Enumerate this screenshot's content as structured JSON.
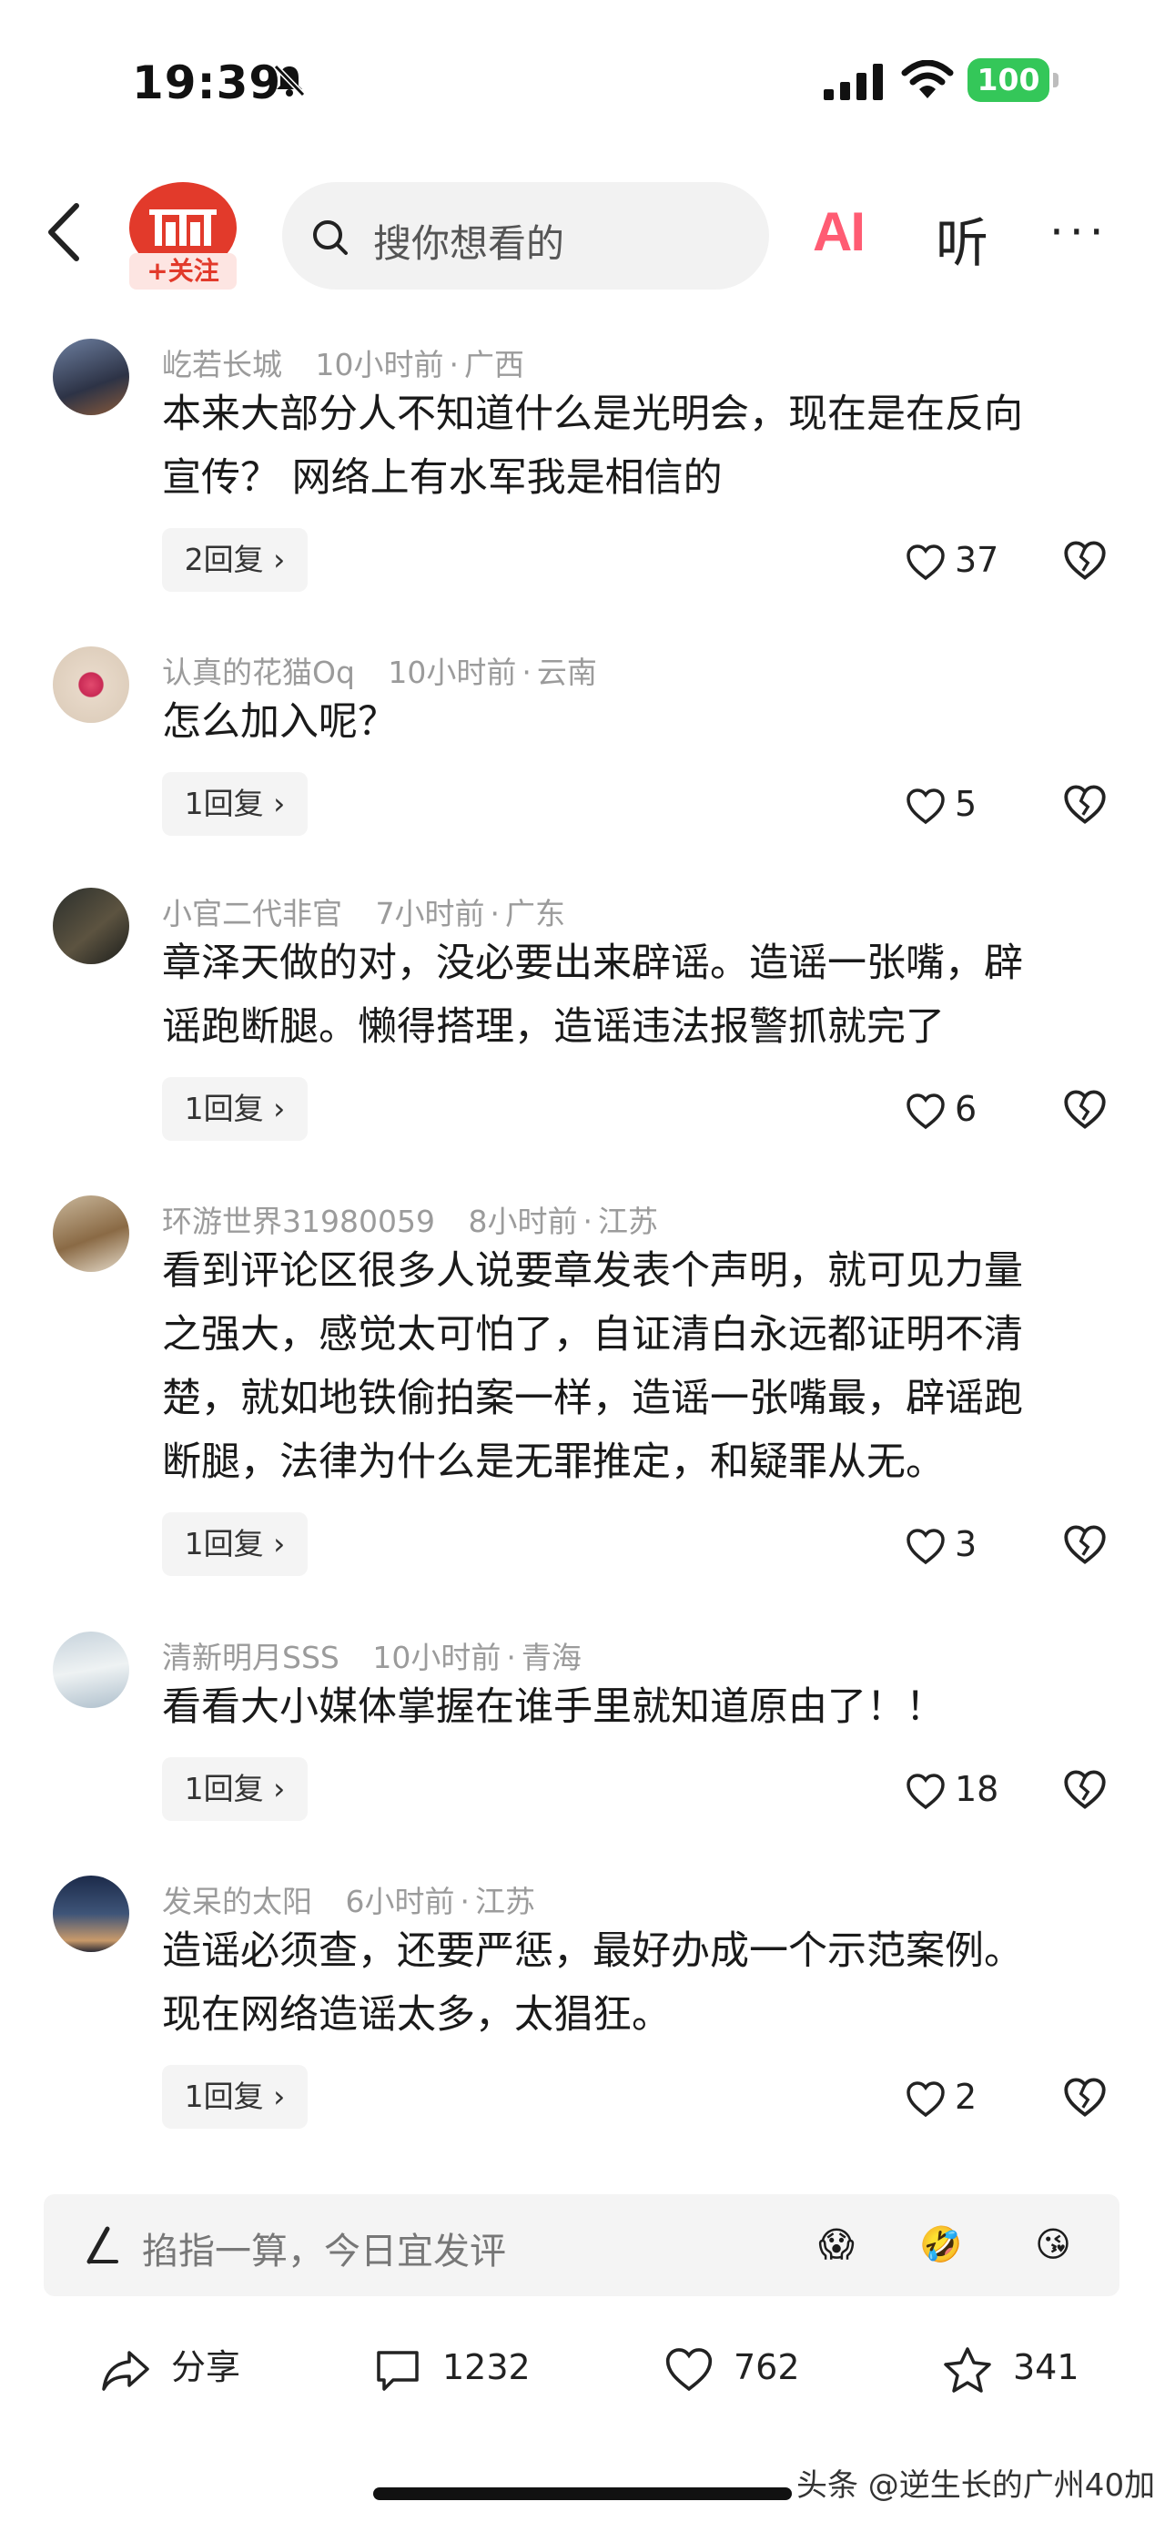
{
  "status": {
    "time": "19:39",
    "battery": "100"
  },
  "nav": {
    "follow_label": "+关注",
    "search_placeholder": "搜你想看的",
    "ai_label": "AI",
    "listen_label": "听",
    "more_label": "···"
  },
  "comments": [
    {
      "user": "屹若长城",
      "time": "10小时前",
      "region": "广西",
      "lines": [
        "本来大部分人不知道什么是光明会，现在是在反向",
        "宣传？ 网络上有水军我是相信的"
      ],
      "replies": "2回复",
      "likes": "37"
    },
    {
      "user": "认真的花猫Oq",
      "time": "10小时前",
      "region": "云南",
      "lines": [
        "怎么加入呢？"
      ],
      "replies": "1回复",
      "likes": "5"
    },
    {
      "user": "小官二代非官",
      "time": "7小时前",
      "region": "广东",
      "lines": [
        "章泽天做的对，没必要出来辟谣。造谣一张嘴，辟",
        "谣跑断腿。懒得搭理，造谣违法报警抓就完了"
      ],
      "replies": "1回复",
      "likes": "6"
    },
    {
      "user": "环游世界31980059",
      "time": "8小时前",
      "region": "江苏",
      "lines": [
        "看到评论区很多人说要章发表个声明，就可见力量",
        "之强大，感觉太可怕了，自证清白永远都证明不清",
        "楚，就如地铁偷拍案一样，造谣一张嘴最，辟谣跑",
        "断腿，法律为什么是无罪推定，和疑罪从无。"
      ],
      "replies": "1回复",
      "likes": "3"
    },
    {
      "user": "清新明月SSS",
      "time": "10小时前",
      "region": "青海",
      "lines": [
        "看看大小媒体掌握在谁手里就知道原由了！！"
      ],
      "replies": "1回复",
      "likes": "18"
    },
    {
      "user": "发呆的太阳",
      "time": "6小时前",
      "region": "江苏",
      "lines": [
        "造谣必须查，还要严惩，最好办成一个示范案例。",
        "现在网络造谣太多，太猖狂。"
      ],
      "replies": "1回复",
      "likes": "2"
    }
  ],
  "input": {
    "placeholder": "掐指一算，今日宜发评",
    "emojis": [
      "😱",
      "🤣",
      "😘"
    ]
  },
  "actions": {
    "share": "分享",
    "comments": "1232",
    "likes": "762",
    "favorites": "341"
  },
  "watermark": "头条 @逆生长的广州40加",
  "icons": [
    "back-icon",
    "search-icon",
    "heart-icon",
    "dislike-heart-icon",
    "share-icon",
    "comment-icon",
    "star-icon",
    "pen-icon"
  ]
}
